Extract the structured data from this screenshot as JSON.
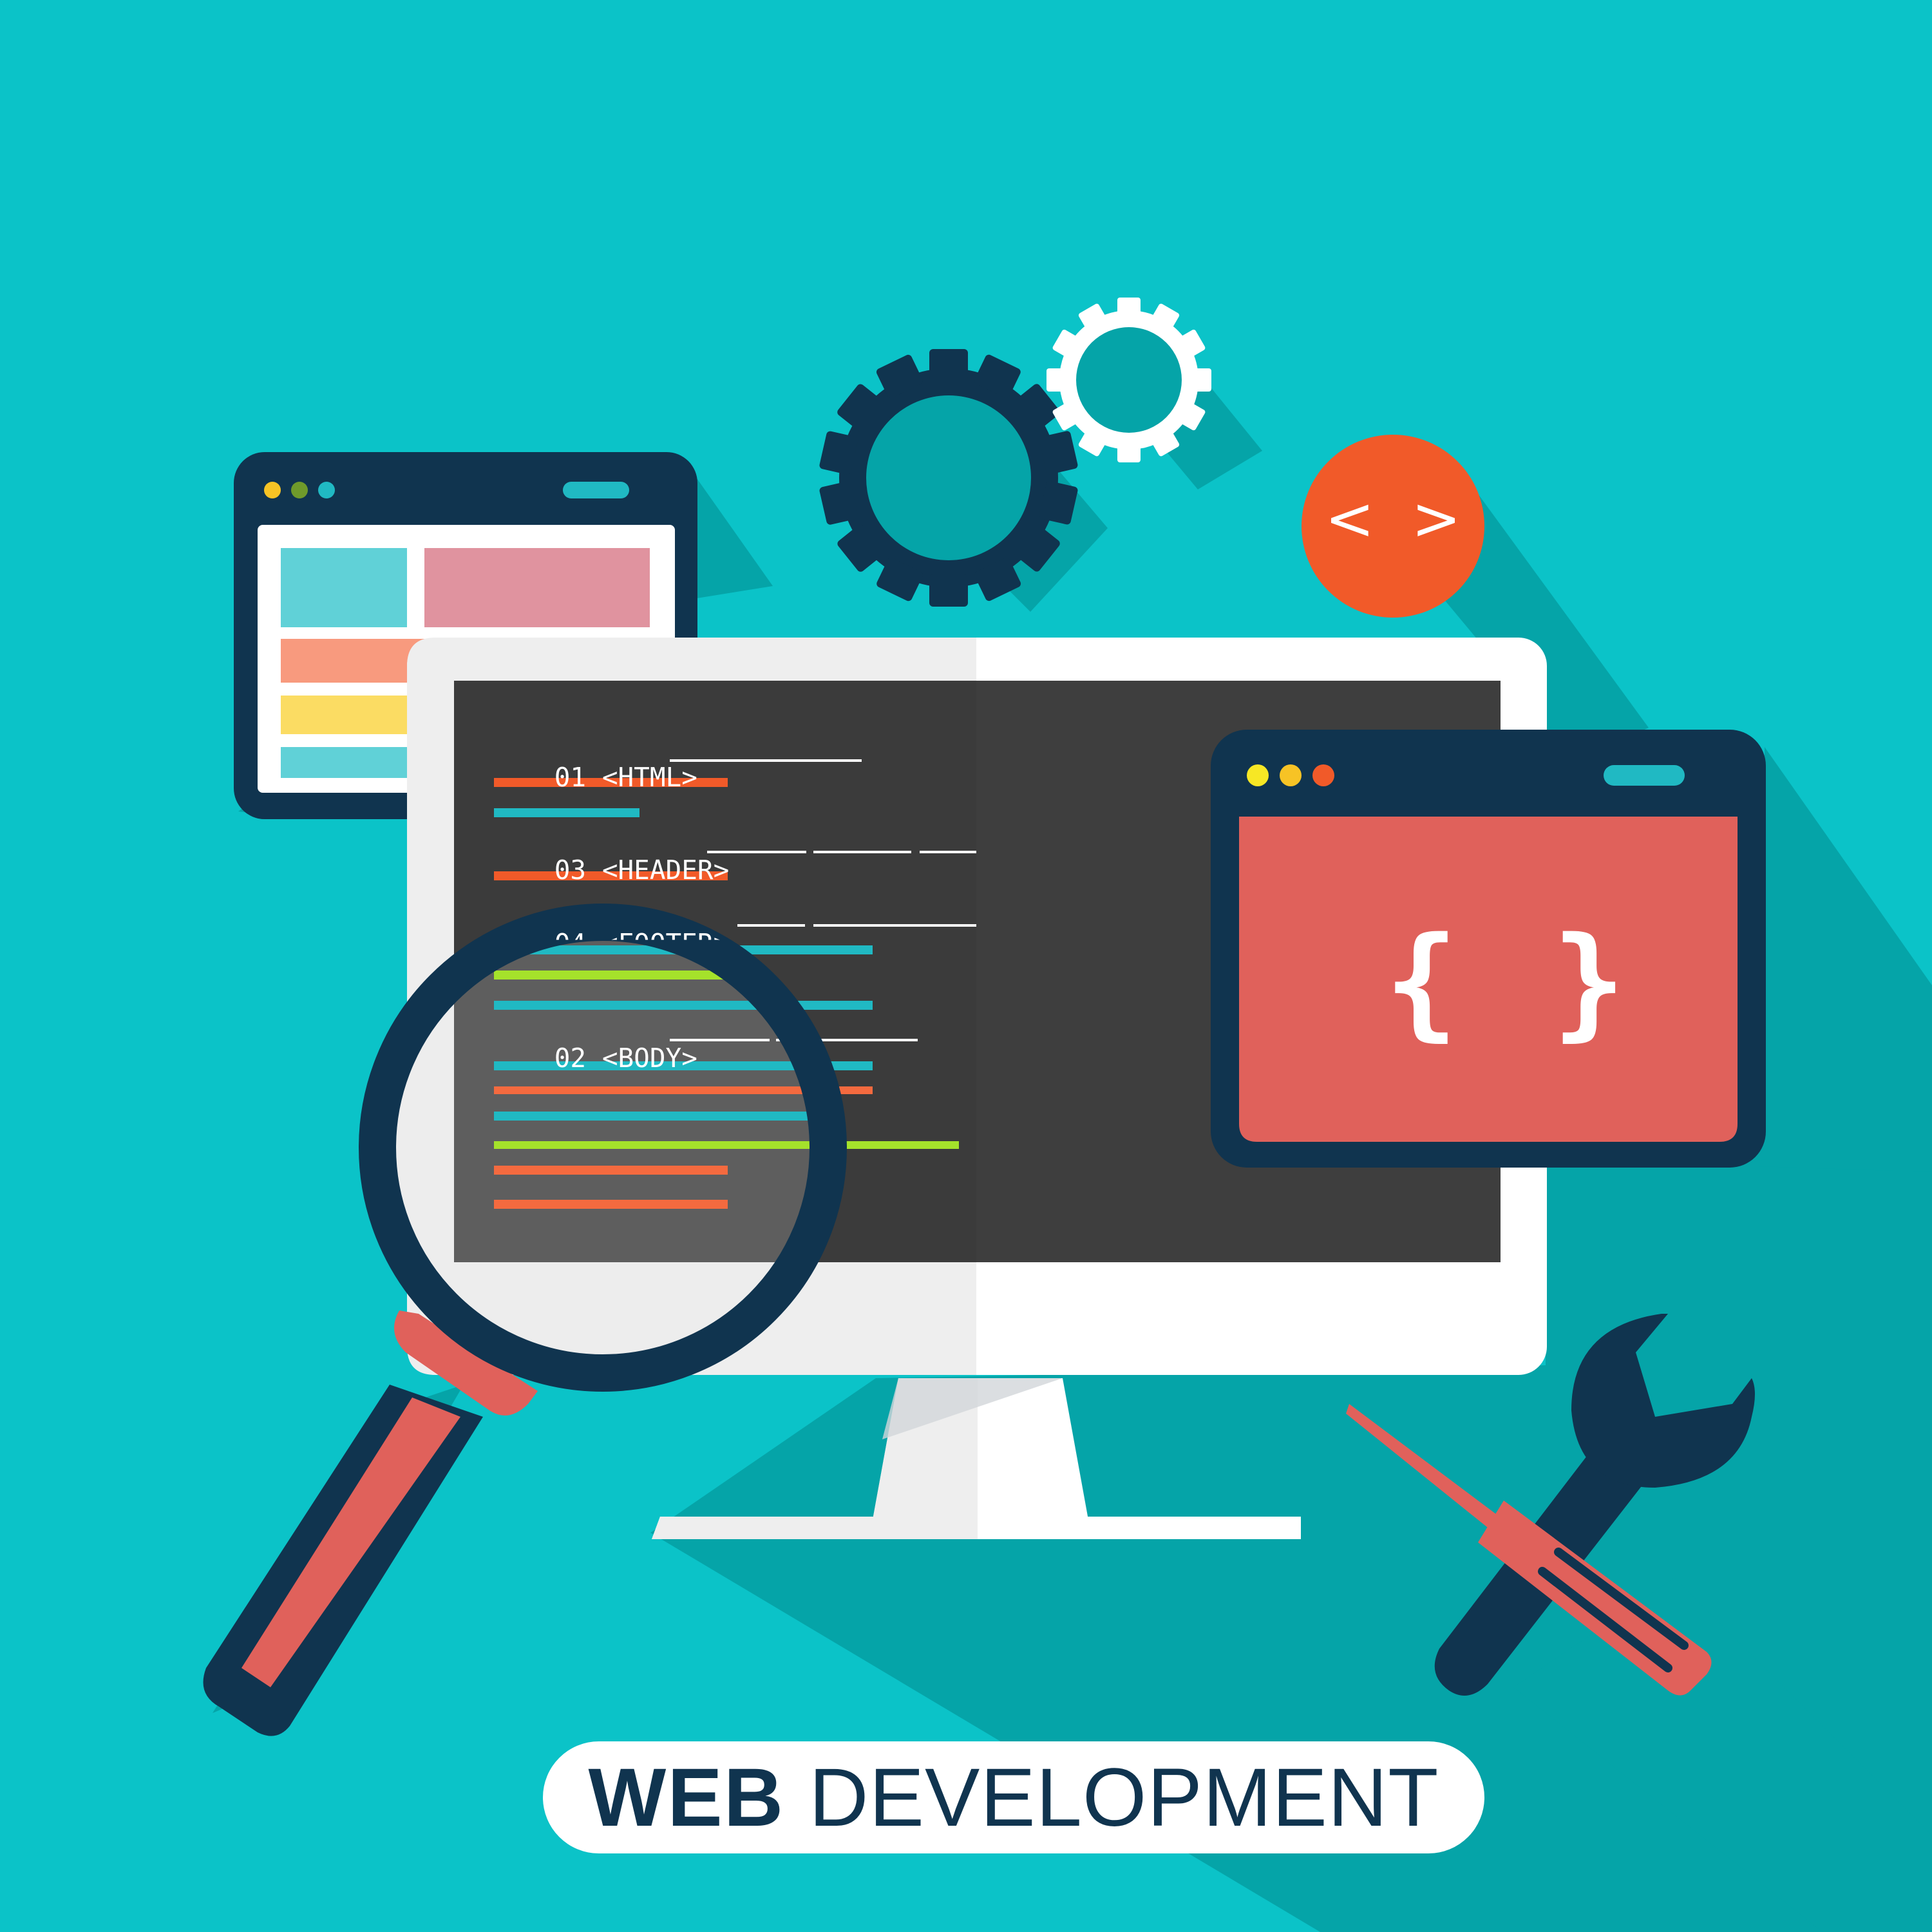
{
  "illustration": {
    "title_bold": "WEB",
    "title_regular": "DEVELOPMENT",
    "code_lines": [
      {
        "number": "01",
        "tag": "<HTML>"
      },
      {
        "number": "03",
        "tag": "<HEADER>"
      },
      {
        "number": "04",
        "tag": "<FOOTER>"
      },
      {
        "number": "02",
        "tag": "<BODY>"
      }
    ],
    "tag_badge": "< >",
    "braces_left": "{",
    "braces_right": "}"
  },
  "colors": {
    "background": "#0bc3c8",
    "shadow": "#05a4a8",
    "navy": "#10344f",
    "orange": "#f15a29",
    "coral": "#e0615b",
    "code_screen": "#3b3b3b",
    "cyan_line": "#20b9c3",
    "lime_line": "#a5e22b",
    "white": "#ffffff"
  },
  "icons": [
    "gear-icon",
    "magnifying-glass-icon",
    "wrench-icon",
    "screwdriver-icon",
    "code-tag-icon",
    "browser-window-icon",
    "monitor-icon"
  ]
}
